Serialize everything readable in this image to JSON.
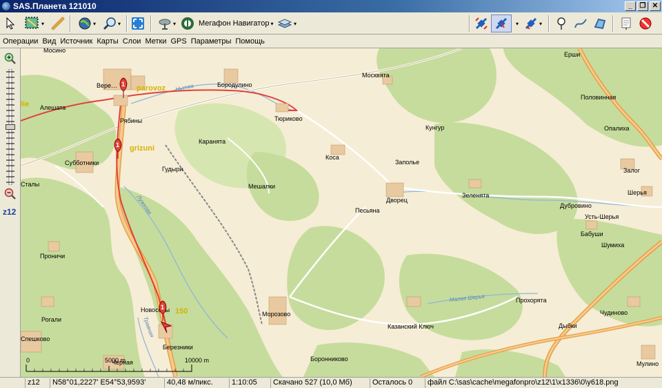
{
  "window": {
    "title": "SAS.Планета 121010",
    "minimize": "_",
    "restore": "❐",
    "close": "✕"
  },
  "toolbar": {
    "map_source": "Мегафон Навигатор",
    "map_source_arrow": "▾"
  },
  "menu": [
    "Операции",
    "Вид",
    "Источник",
    "Карты",
    "Слои",
    "Метки",
    "GPS",
    "Параметры",
    "Помощь"
  ],
  "zoom": {
    "level": "z12"
  },
  "map": {
    "places": [
      "Мосино",
      "Ерши",
      "Бородулино",
      "Москвята",
      "Половинная",
      "Алешата",
      "Рябины",
      "Тюриково",
      "Кунгур",
      "Опалиха",
      "Субботники",
      "Каранята",
      "Коса",
      "Заполье",
      "Залог",
      "Гудыри",
      "Шерья",
      "Мешалки",
      "Песьяна",
      "Дворец",
      "Зеленята",
      "Дубровино",
      "Усть-Шерья",
      "Бабуши",
      "Шумиха",
      "Проничи",
      "Прохорята",
      "Чудиново",
      "Рогали",
      "Новоселы",
      "Морозово",
      "Казанский Ключ",
      "Дыбки",
      "Березники",
      "Спешково",
      "Черная",
      "Боронниково",
      "Мулино",
      "Сталы",
      "Вере…"
    ],
    "rivers": [
      "Нытва",
      "Лужкова",
      "Малая Шерья",
      "Травная"
    ],
    "markers": [
      {
        "number": "1",
        "label": "parovoz"
      },
      {
        "number": "1",
        "label": "grizuni"
      },
      {
        "number": "1",
        "label": "150"
      }
    ],
    "scale": {
      "zero": "0",
      "mid": "5000 m",
      "end": "10000 m"
    },
    "edge_labels": {
      "left_top": "lie"
    }
  },
  "status": {
    "zoom": "z12",
    "coords": "N58°01,2227' E54°53,9593'",
    "scale": "40,48 м/пикс.",
    "time": "1:10:05",
    "downloaded": "Скачано 527 (10,0 Мб)",
    "remaining": "Осталось 0",
    "file": "файл C:\\sas\\cache\\megafonpro\\z12\\1\\x1336\\0\\y618.png"
  }
}
